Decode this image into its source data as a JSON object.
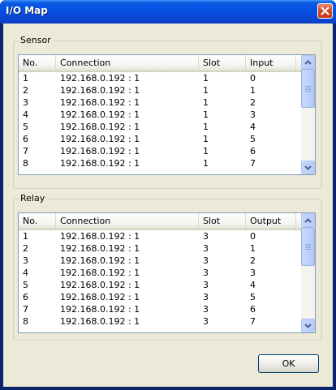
{
  "window": {
    "title": "I/O Map"
  },
  "sensor": {
    "legend": "Sensor",
    "columns": [
      "No.",
      "Connection",
      "Slot",
      "Input"
    ],
    "rows": [
      [
        "1",
        "192.168.0.192 : 1",
        "1",
        "0"
      ],
      [
        "2",
        "192.168.0.192 : 1",
        "1",
        "1"
      ],
      [
        "3",
        "192.168.0.192 : 1",
        "1",
        "2"
      ],
      [
        "4",
        "192.168.0.192 : 1",
        "1",
        "3"
      ],
      [
        "5",
        "192.168.0.192 : 1",
        "1",
        "4"
      ],
      [
        "6",
        "192.168.0.192 : 1",
        "1",
        "5"
      ],
      [
        "7",
        "192.168.0.192 : 1",
        "1",
        "6"
      ],
      [
        "8",
        "192.168.0.192 : 1",
        "1",
        "7"
      ]
    ]
  },
  "relay": {
    "legend": "Relay",
    "columns": [
      "No.",
      "Connection",
      "Slot",
      "Output"
    ],
    "rows": [
      [
        "1",
        "192.168.0.192 : 1",
        "3",
        "0"
      ],
      [
        "2",
        "192.168.0.192 : 1",
        "3",
        "1"
      ],
      [
        "3",
        "192.168.0.192 : 1",
        "3",
        "2"
      ],
      [
        "4",
        "192.168.0.192 : 1",
        "3",
        "3"
      ],
      [
        "5",
        "192.168.0.192 : 1",
        "3",
        "4"
      ],
      [
        "6",
        "192.168.0.192 : 1",
        "3",
        "5"
      ],
      [
        "7",
        "192.168.0.192 : 1",
        "3",
        "6"
      ],
      [
        "8",
        "192.168.0.192 : 1",
        "3",
        "7"
      ]
    ]
  },
  "buttons": {
    "ok": "OK"
  }
}
